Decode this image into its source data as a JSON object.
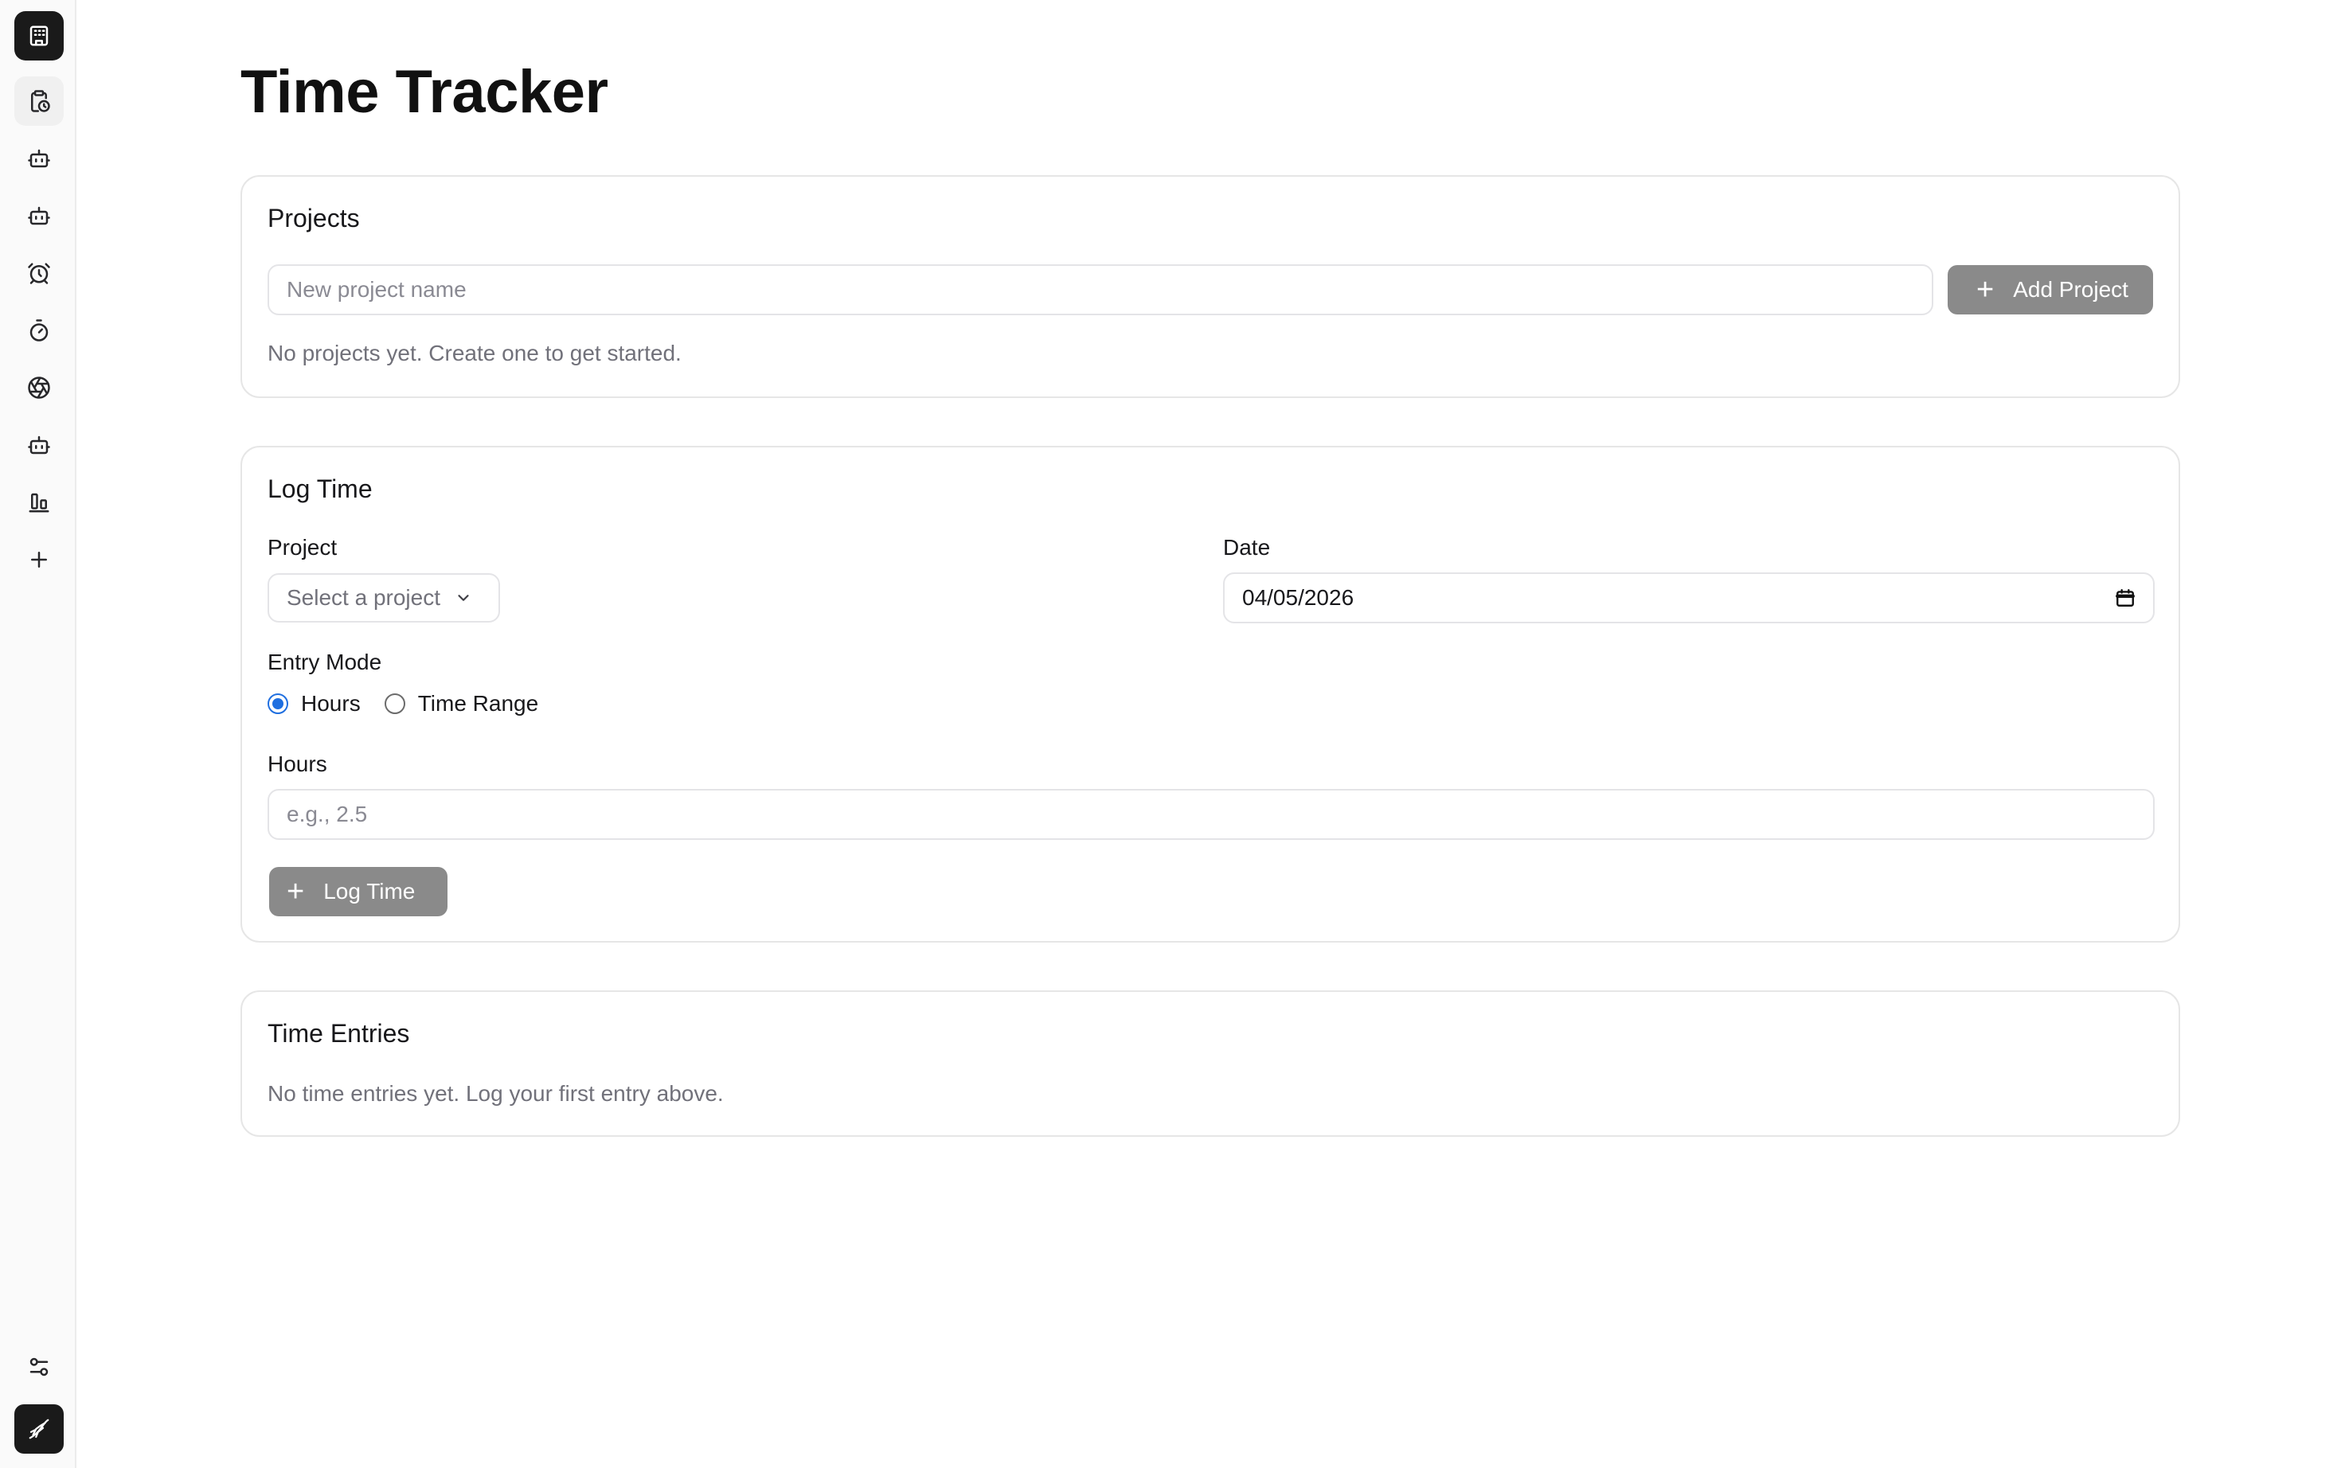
{
  "sidebar": {
    "items": [
      {
        "icon": "building-icon"
      },
      {
        "icon": "clipboard-clock-icon"
      },
      {
        "icon": "bot-icon"
      },
      {
        "icon": "bot-icon"
      },
      {
        "icon": "alarm-clock-icon"
      },
      {
        "icon": "timer-icon"
      },
      {
        "icon": "aperture-icon"
      },
      {
        "icon": "bot-icon"
      },
      {
        "icon": "bar-chart-icon"
      },
      {
        "icon": "plus-icon"
      }
    ],
    "bottom": [
      {
        "icon": "settings-sliders-icon"
      },
      {
        "icon": "avatar-icon"
      }
    ]
  },
  "page": {
    "title": "Time Tracker"
  },
  "projects": {
    "title": "Projects",
    "input_placeholder": "New project name",
    "add_button": "Add Project",
    "empty_message": "No projects yet. Create one to get started."
  },
  "log_time": {
    "title": "Log Time",
    "project_label": "Project",
    "project_select": "Select a project",
    "date_label": "Date",
    "date_value": "04/05/2026",
    "entry_mode_label": "Entry Mode",
    "mode_hours": "Hours",
    "mode_time_range": "Time Range",
    "selected_mode": "Hours",
    "hours_label": "Hours",
    "hours_placeholder": "e.g., 2.5",
    "submit_button": "Log Time"
  },
  "time_entries": {
    "title": "Time Entries",
    "empty_message": "No time entries yet. Log your first entry above."
  },
  "colors": {
    "accent": "#1f6fe0",
    "button_disabled": "#8a8a8a",
    "border": "#e6e6e6"
  }
}
